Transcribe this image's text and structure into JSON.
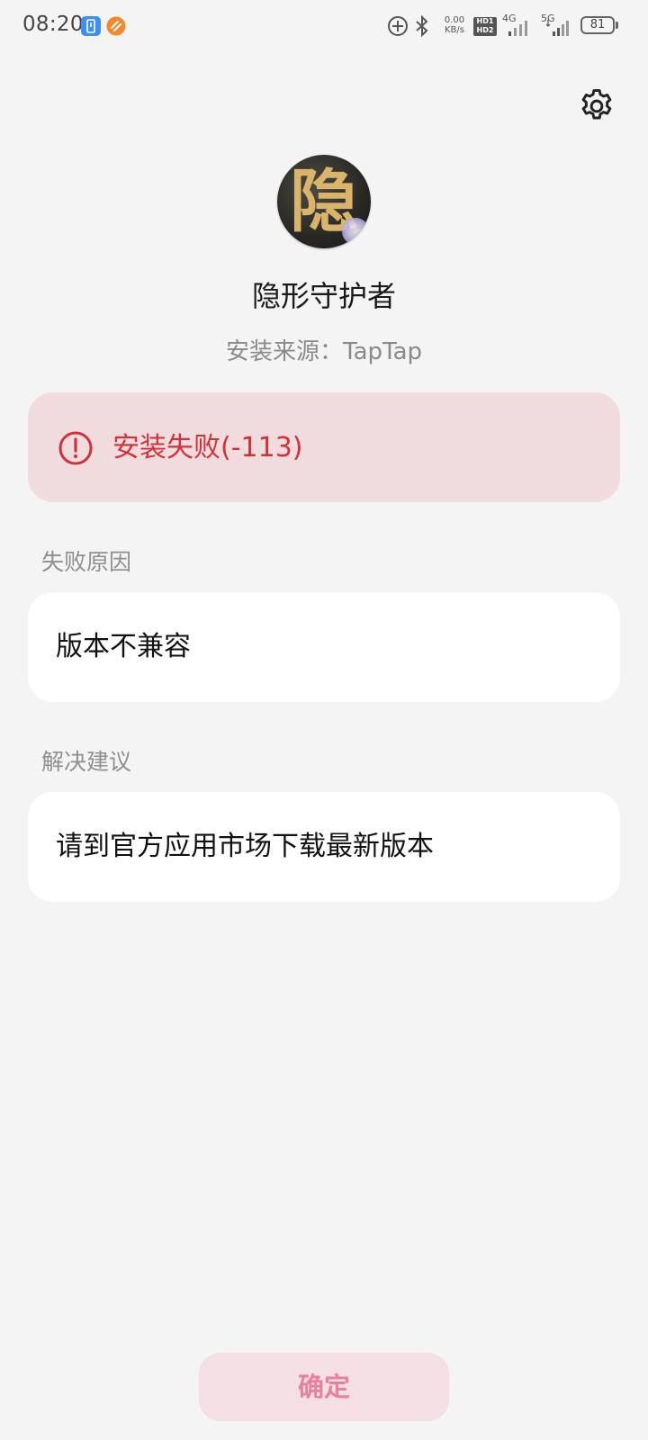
{
  "status_bar": {
    "time": "08:20",
    "net_speed_value": "0.00",
    "net_speed_unit": "KB/s",
    "sim1_label": "HD1",
    "sim2_label": "HD2",
    "sim1_type": "4G",
    "sim2_type": "5G",
    "battery": "81",
    "icons": [
      "phone-clone-icon",
      "app-notification-icon",
      "data-saver-icon",
      "bluetooth-icon",
      "signal-4g-icon",
      "signal-5g-icon",
      "battery-icon"
    ]
  },
  "header": {
    "settings_icon": "gear-icon"
  },
  "app": {
    "icon_glyph": "隐",
    "name": "隐形守护者",
    "source": "安装来源：TapTap"
  },
  "error": {
    "icon": "error-circle-icon",
    "message": "安装失败(-113)",
    "color": "#d2303a",
    "background": "#f0dcdd"
  },
  "failure_reason": {
    "label": "失败原因",
    "value": "版本不兼容"
  },
  "suggestion": {
    "label": "解决建议",
    "value": "请到官方应用市场下载最新版本"
  },
  "confirm": {
    "label": "确定",
    "color": "#e8819e",
    "background": "#f4dfe4"
  }
}
